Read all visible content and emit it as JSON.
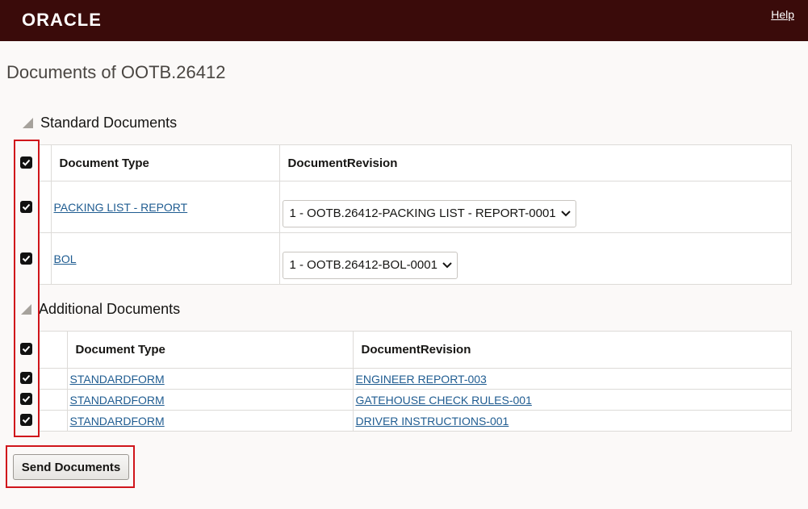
{
  "header": {
    "logo": "ORACLE",
    "help": "Help"
  },
  "page": {
    "title": "Documents of OOTB.26412"
  },
  "standard": {
    "heading": "Standard Documents",
    "col_type": "Document Type",
    "col_revision": "DocumentRevision",
    "rows": [
      {
        "type": "PACKING LIST - REPORT",
        "revision": "1 - OOTB.26412-PACKING LIST - REPORT-0001",
        "checked": true
      },
      {
        "type": "BOL",
        "revision": "1 - OOTB.26412-BOL-0001",
        "checked": true
      }
    ],
    "header_checked": true
  },
  "additional": {
    "heading": "Additional Documents",
    "col_type": "Document Type",
    "col_revision": "DocumentRevision",
    "rows": [
      {
        "type": "STANDARDFORM",
        "revision": "ENGINEER REPORT-003",
        "checked": true
      },
      {
        "type": "STANDARDFORM",
        "revision": "GATEHOUSE CHECK RULES-001",
        "checked": true
      },
      {
        "type": "STANDARDFORM",
        "revision": "DRIVER INSTRUCTIONS-001",
        "checked": true
      }
    ],
    "header_checked": true
  },
  "actions": {
    "send_label": "Send Documents"
  },
  "colors": {
    "header_bg": "#3a0b0a",
    "link": "#1f5c91",
    "highlight": "#d0151b"
  }
}
